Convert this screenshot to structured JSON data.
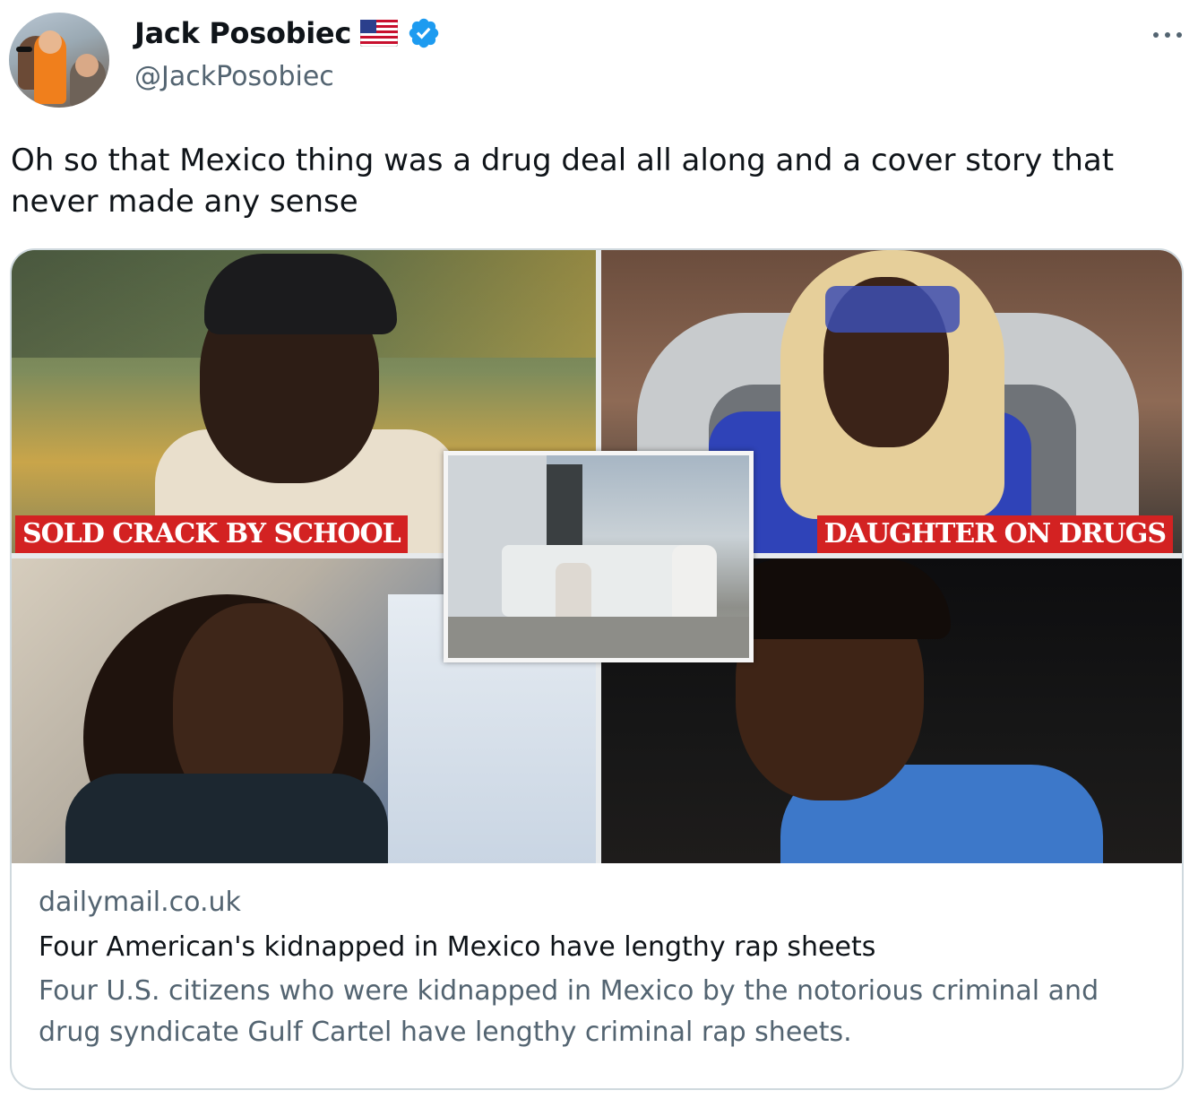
{
  "author": {
    "display_name": "Jack Posobiec",
    "handle": "@JackPosobiec",
    "flag_emoji": "🇺🇸",
    "verified": true,
    "verified_color": "#1d9bf0"
  },
  "tweet": {
    "text": "Oh so that Mexico thing was a drug deal all along and a cover story that never made any sense"
  },
  "link_card": {
    "domain": "dailymail.co.uk",
    "title": "Four American's kidnapped in Mexico have lengthy rap sheets",
    "description": "Four U.S. citizens who were kidnapped in Mexico by the notorious criminal and drug syndicate Gulf Cartel have lengthy criminal rap sheets.",
    "image": {
      "banner_left": "SOLD CRACK BY SCHOOL",
      "banner_right": "DAUGHTER ON DRUGS",
      "banner_color": "#d32222"
    }
  },
  "icons": {
    "more": "more-horizontal-icon",
    "verified": "verified-badge-icon",
    "flag": "us-flag-icon"
  }
}
